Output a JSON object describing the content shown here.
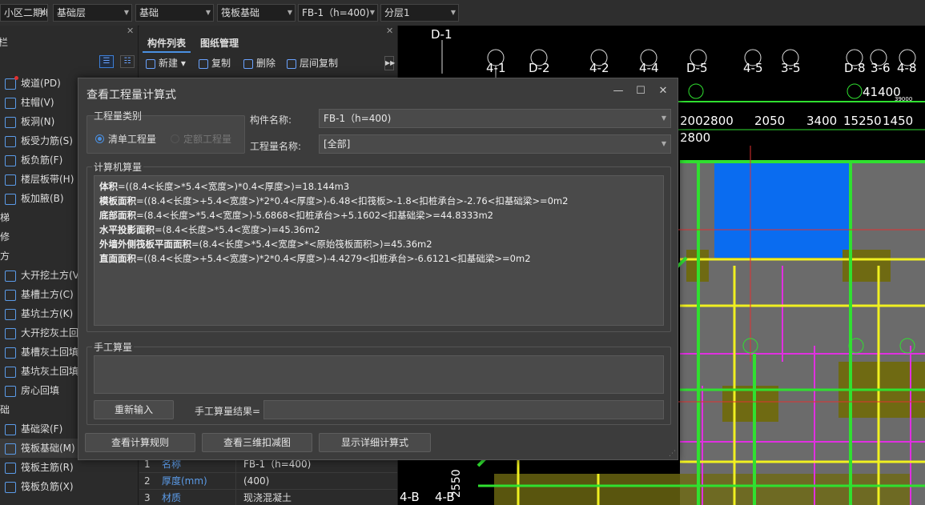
{
  "topbar": {
    "combos": [
      "小区二期地",
      "基础层",
      "基础",
      "筏板基础",
      "FB-1（h=400)",
      "分层1"
    ]
  },
  "leftpanel": {
    "header": "栏",
    "items": [
      {
        "label": "坡道(PD)",
        "icon": "ramp-icon"
      },
      {
        "label": "柱帽(V)",
        "icon": "column-cap-icon"
      },
      {
        "label": "板洞(N)",
        "icon": "slab-opening-icon"
      },
      {
        "label": "板受力筋(S)",
        "icon": "slab-rebar-icon"
      },
      {
        "label": "板负筋(F)",
        "icon": "slab-neg-rebar-icon"
      },
      {
        "label": "楼层板带(H)",
        "icon": "slab-strip-icon"
      },
      {
        "label": "板加腋(B)",
        "icon": "slab-haunch-icon"
      }
    ],
    "cats": [
      "梯",
      "修",
      "方"
    ],
    "items2": [
      {
        "label": "大开挖土方(V",
        "icon": "excavation-icon"
      },
      {
        "label": "基槽土方(C)",
        "icon": "trench-icon"
      },
      {
        "label": "基坑土方(K)",
        "icon": "pit-icon"
      },
      {
        "label": "大开挖灰土回",
        "icon": "backfill-icon"
      },
      {
        "label": "基槽灰土回填",
        "icon": "trench-backfill-icon"
      },
      {
        "label": "基坑灰土回填",
        "icon": "pit-backfill-icon"
      },
      {
        "label": "房心回填",
        "icon": "room-backfill-icon"
      }
    ],
    "cat2": "础",
    "items3": [
      {
        "label": "基础梁(F)",
        "icon": "foundation-beam-icon"
      },
      {
        "label": "筏板基础(M)",
        "icon": "raft-foundation-icon"
      },
      {
        "label": "筏板主筋(R)",
        "icon": "raft-main-rebar-icon"
      },
      {
        "label": "筏板负筋(X)",
        "icon": "raft-neg-rebar-icon"
      }
    ]
  },
  "midpanel": {
    "tabs": [
      "构件列表",
      "图纸管理"
    ],
    "tools": [
      "新建",
      "复制",
      "删除",
      "层间复制"
    ],
    "props": [
      {
        "num": "1",
        "key": "名称",
        "val": "FB-1（h=400)"
      },
      {
        "num": "2",
        "key": "厚度(mm)",
        "val": "(400)"
      },
      {
        "num": "3",
        "key": "材质",
        "val": "现浇混凝土"
      }
    ]
  },
  "cad": {
    "axis_labels_top": [
      "D-1",
      "4-1",
      "D-2",
      "4-2",
      "4-4",
      "D-5",
      "4-5",
      "3-5",
      "D-8",
      "3-6",
      "4-8"
    ],
    "dims": [
      "2002800",
      "2050",
      "3400",
      "15250",
      "1450",
      "2800",
      "41400",
      "39000"
    ],
    "bottom_labels": [
      "4-B",
      "4-B",
      "2550"
    ]
  },
  "dialog": {
    "title": "查看工程量计算式",
    "group_type": "工程量类别",
    "radio_list": "清单工程量",
    "radio_quota": "定额工程量",
    "label_component": "构件名称:",
    "component_value": "FB-1（h=400)",
    "label_qty": "工程量名称:",
    "qty_value": "[全部]",
    "group_computer": "计算机算量",
    "formulas": [
      {
        "name": "体积",
        "expr": "=((8.4<长度>*5.4<宽度>)*0.4<厚度>)=18.144m3"
      },
      {
        "name": "模板面积",
        "expr": "=((8.4<长度>+5.4<宽度>)*2*0.4<厚度>)-6.48<扣筏板>-1.8<扣桩承台>-2.76<扣基础梁>=0m2"
      },
      {
        "name": "底部面积",
        "expr": "=(8.4<长度>*5.4<宽度>)-5.6868<扣桩承台>+5.1602<扣基础梁>=44.8333m2"
      },
      {
        "name": "水平投影面积",
        "expr": "=(8.4<长度>*5.4<宽度>)=45.36m2"
      },
      {
        "name": "外墙外侧筏板平面面积",
        "expr": "=(8.4<长度>*5.4<宽度>*<原始筏板面积>)=45.36m2"
      },
      {
        "name": "直面面积",
        "expr": "=((8.4<长度>+5.4<宽度>)*2*0.4<厚度>)-4.4279<扣桩承台>-6.6121<扣基础梁>=0m2"
      }
    ],
    "group_manual": "手工算量",
    "btn_reenter": "重新输入",
    "label_manual_result": "手工算量结果=",
    "manual_result": "",
    "btn_rules": "查看计算规则",
    "btn_3d": "查看三维扣减图",
    "btn_detail": "显示详细计算式"
  }
}
